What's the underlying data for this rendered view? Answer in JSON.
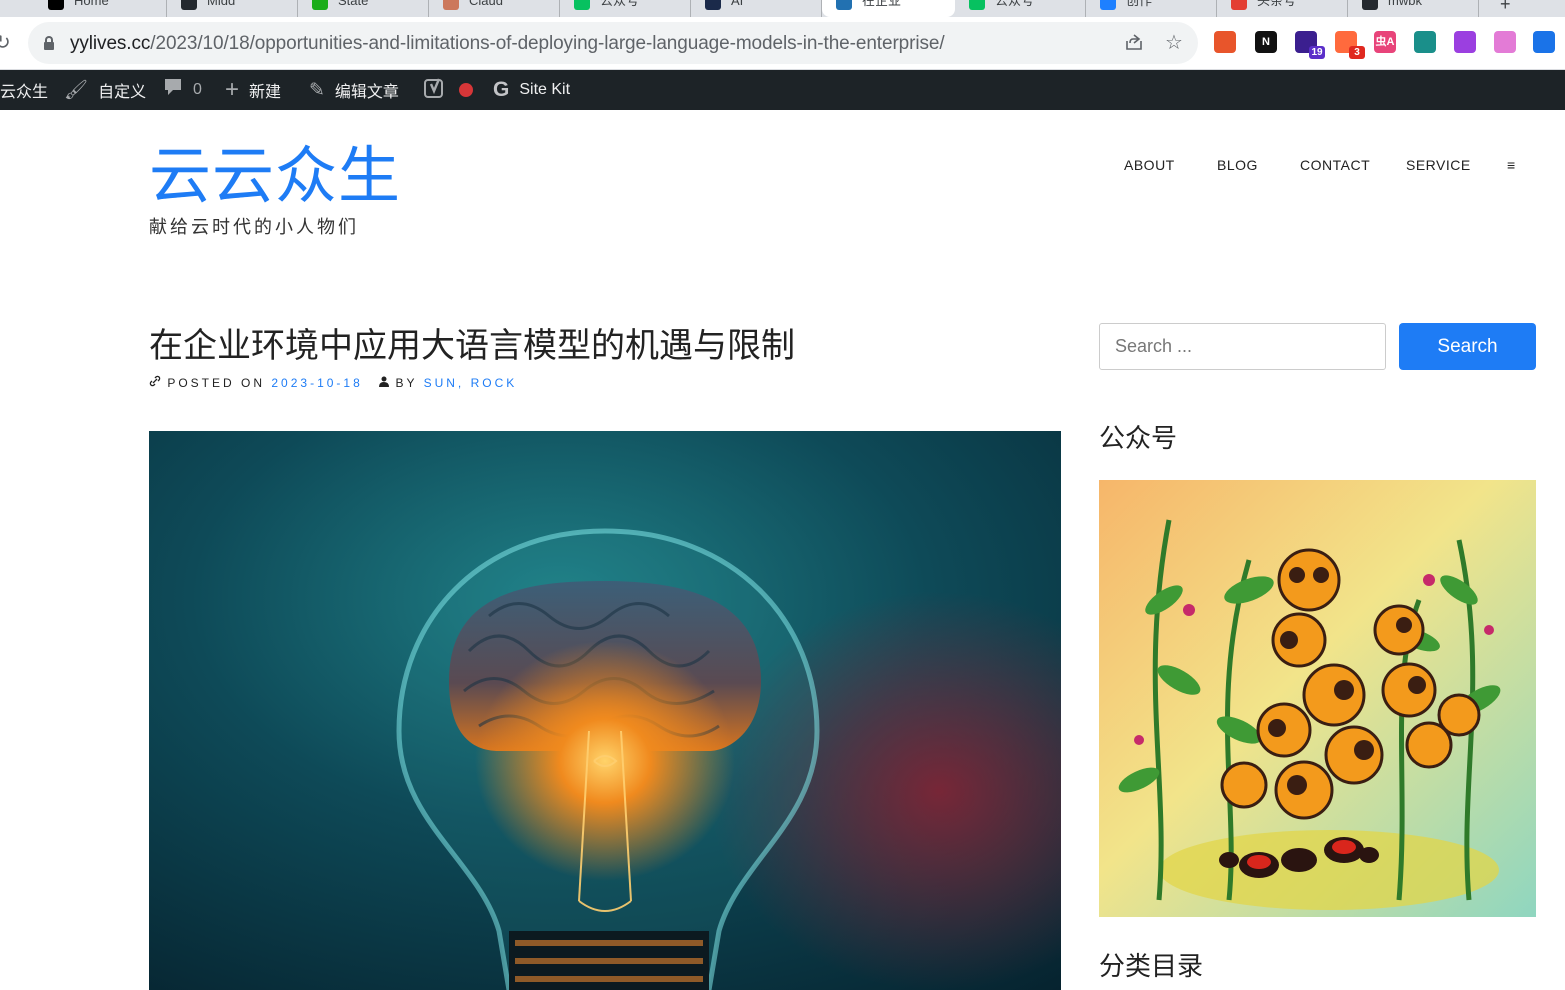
{
  "browser": {
    "tabs": [
      {
        "label": "Home",
        "color": "#000000"
      },
      {
        "label": "Midd",
        "color": "#24292f"
      },
      {
        "label": "State",
        "color": "#1aad19"
      },
      {
        "label": "Claud",
        "color": "#cc785c"
      },
      {
        "label": "公众号",
        "color": "#07c160"
      },
      {
        "label": "AI",
        "color": "#1b2a4a"
      },
      {
        "label": "在企业",
        "color": "#2271b1"
      },
      {
        "label": "公众号",
        "color": "#07c160"
      },
      {
        "label": "创作",
        "color": "#1e80ff"
      },
      {
        "label": "头条号",
        "color": "#e33e33"
      },
      {
        "label": "mwbk",
        "color": "#24292f"
      }
    ],
    "url_host": "yylives.cc",
    "url_path": "/2023/10/18/opportunities-and-limitations-of-deploying-large-language-models-in-the-enterprise/",
    "extensions": [
      {
        "icon": "circle-ext-icon",
        "label": "",
        "color": "#e8552b"
      },
      {
        "icon": "notion-icon",
        "label": "N",
        "color": "#111111"
      },
      {
        "icon": "graduation-cap-icon",
        "label": "",
        "color": "#3b1f8f",
        "badge": "19",
        "badge_color": "#5b2fc9"
      },
      {
        "icon": "bubbles-icon",
        "label": "",
        "color": "#ff6a3d",
        "badge": "3",
        "badge_color": "#e0281f"
      },
      {
        "icon": "translate-icon",
        "label": "虫A",
        "color": "#e8447a"
      },
      {
        "icon": "ai-ext-icon",
        "label": "",
        "color": "#1a8f8a"
      },
      {
        "icon": "purple-ext-icon",
        "label": "",
        "color": "#9b3fe0"
      },
      {
        "icon": "cloud-ext-icon",
        "label": "",
        "color": "#e37bd6"
      },
      {
        "icon": "feather-ext-icon",
        "label": "",
        "color": "#1a73e8"
      }
    ]
  },
  "adminbar": {
    "site_name": "云众生",
    "customize": "自定义",
    "comments_count": "0",
    "new": "新建",
    "edit_post": "编辑文章",
    "site_kit": "Site Kit"
  },
  "site": {
    "title": "云云众生",
    "description": "献给云时代的小人物们",
    "nav": [
      "ABOUT",
      "BLOG",
      "CONTACT",
      "SERVICE",
      "≡"
    ]
  },
  "post": {
    "title": "在企业环境中应用大语言模型的机遇与限制",
    "posted_on_label": "POSTED ON",
    "date": "2023-10-18",
    "by_label": "BY",
    "author": "SUN, ROCK",
    "image": "lightbulb-brain-image"
  },
  "sidebar": {
    "search_placeholder": "Search ...",
    "search_button": "Search",
    "widget_wechat_title": "公众号",
    "widget_wechat_image": "ants-illustration-image",
    "widget_categories_title": "分类目录"
  }
}
